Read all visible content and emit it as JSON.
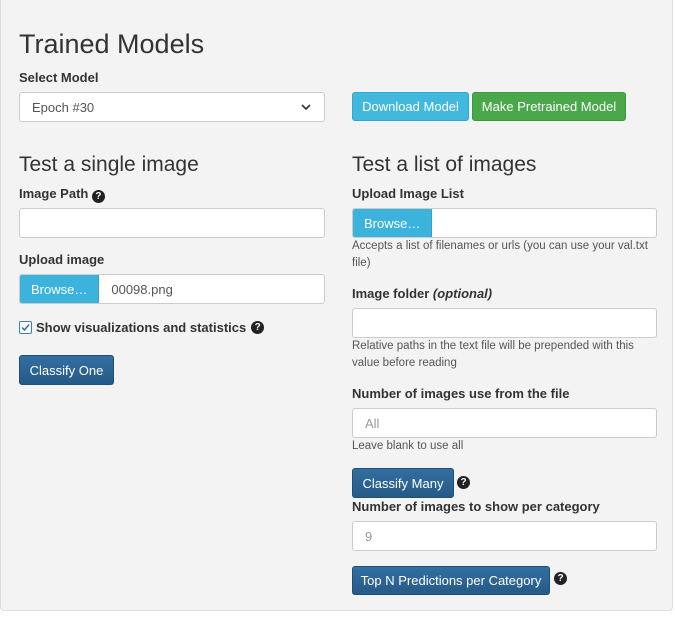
{
  "page_title": "Trained Models",
  "select_model": {
    "label": "Select Model",
    "selected": "Epoch #30"
  },
  "buttons": {
    "download_model": "Download Model",
    "make_pretrained": "Make Pretrained Model",
    "classify_one": "Classify One",
    "classify_many": "Classify Many",
    "top_n": "Top N Predictions per Category"
  },
  "single": {
    "heading": "Test a single image",
    "image_path_label": "Image Path",
    "image_path_value": "",
    "upload_label": "Upload image",
    "browse_label": "Browse…",
    "file_name": "00098.png",
    "show_vis_label": "Show visualizations and statistics",
    "show_vis_checked": true
  },
  "list": {
    "heading": "Test a list of images",
    "upload_label": "Upload Image List",
    "browse_label": "Browse…",
    "file_name": "",
    "upload_help": "Accepts a list of filenames or urls (you can use your val.txt file)",
    "folder_label": "Image folder",
    "folder_optional": "(optional)",
    "folder_value": "",
    "folder_help": "Relative paths in the text file will be prepended with this value before reading",
    "num_images_label": "Number of images use from the file",
    "num_images_placeholder": "All",
    "num_images_help": "Leave blank to use all",
    "per_category_label": "Number of images to show per category",
    "per_category_placeholder": "9"
  },
  "icons": {
    "help": "question-circle-icon",
    "checkbox": "check-icon",
    "dropdown": "chevron-down-icon"
  },
  "colors": {
    "info": "#42b8dd",
    "success": "#4aa84a",
    "primary": "#29618f",
    "panel_bg": "#f3f3f3"
  }
}
